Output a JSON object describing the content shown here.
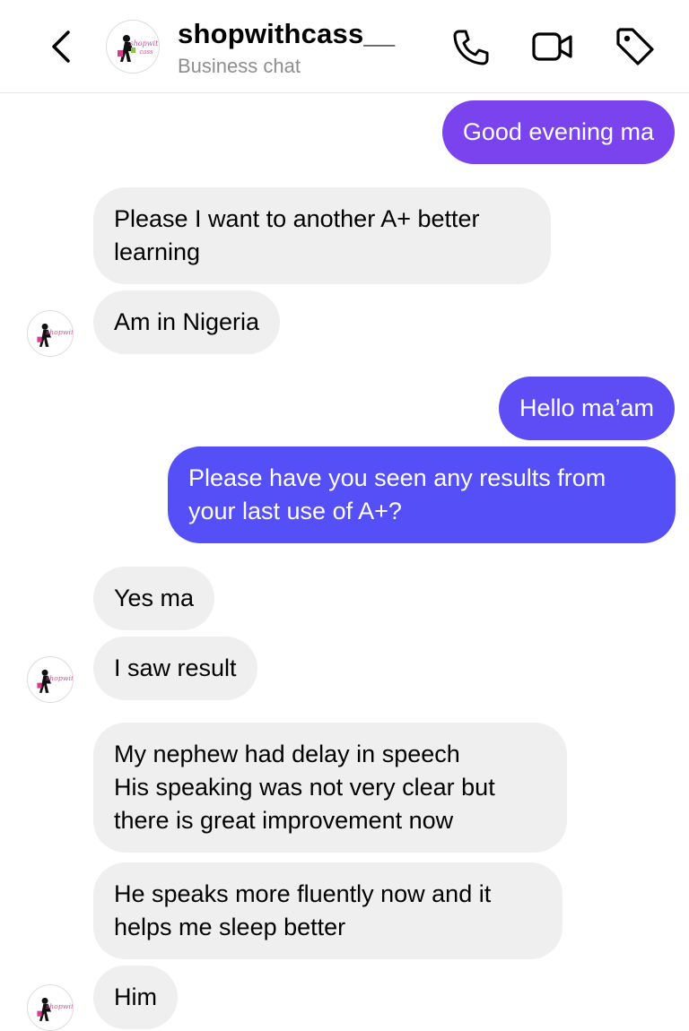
{
  "header": {
    "title": "shopwithcass__",
    "subtitle": "Business chat",
    "avatar_text": "shopwith cass"
  },
  "messages": [
    {
      "id": "m1",
      "direction": "sent",
      "text": "Good evening ma"
    },
    {
      "id": "m2",
      "direction": "received",
      "text": "Please I want to another A+ better\nlearning"
    },
    {
      "id": "m3",
      "direction": "received",
      "text": "Am in Nigeria"
    },
    {
      "id": "m4",
      "direction": "sent",
      "text": "Hello ma’am"
    },
    {
      "id": "m5",
      "direction": "sent",
      "text": "Please have you seen any results from\nyour last use of A+?"
    },
    {
      "id": "m6",
      "direction": "received",
      "text": "Yes ma"
    },
    {
      "id": "m7",
      "direction": "received",
      "text": "I saw result"
    },
    {
      "id": "m8",
      "direction": "received",
      "text": "My nephew had delay in speech\nHis speaking was not very clear but\nthere is great improvement now"
    },
    {
      "id": "m9",
      "direction": "received",
      "text": "He speaks more fluently now and it\nhelps me sleep better"
    },
    {
      "id": "m10",
      "direction": "received",
      "text": "Him"
    }
  ],
  "icons": {
    "back": "chevron-left-icon",
    "call": "phone-icon",
    "video": "video-camera-icon",
    "tag": "tag-icon"
  },
  "colors": {
    "sent_top": "#7a43ee",
    "sent_bottom": "#544ff6",
    "received": "#efefef",
    "subtitle": "#8e8e8e"
  }
}
